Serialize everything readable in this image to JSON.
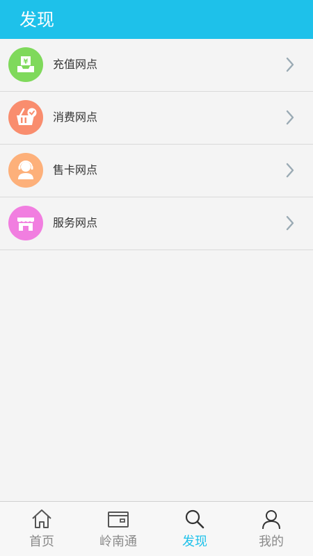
{
  "header": {
    "title": "发现"
  },
  "list": {
    "items": [
      {
        "label": "充值网点",
        "icon": "recharge-icon",
        "color": "#7fd95b"
      },
      {
        "label": "消费网点",
        "icon": "basket-icon",
        "color": "#f98d6e"
      },
      {
        "label": "售卡网点",
        "icon": "agent-icon",
        "color": "#fdb07a"
      },
      {
        "label": "服务网点",
        "icon": "store-icon",
        "color": "#f17ee0"
      }
    ]
  },
  "tabbar": {
    "tabs": [
      {
        "label": "首页",
        "icon": "home-icon",
        "active": false
      },
      {
        "label": "岭南通",
        "icon": "card-icon",
        "active": false
      },
      {
        "label": "发现",
        "icon": "search-icon",
        "active": true
      },
      {
        "label": "我的",
        "icon": "user-icon",
        "active": false
      }
    ]
  },
  "colors": {
    "accent": "#1ec1ea",
    "inactive": "#8a8a8a",
    "chevron": "#9aaab4"
  }
}
